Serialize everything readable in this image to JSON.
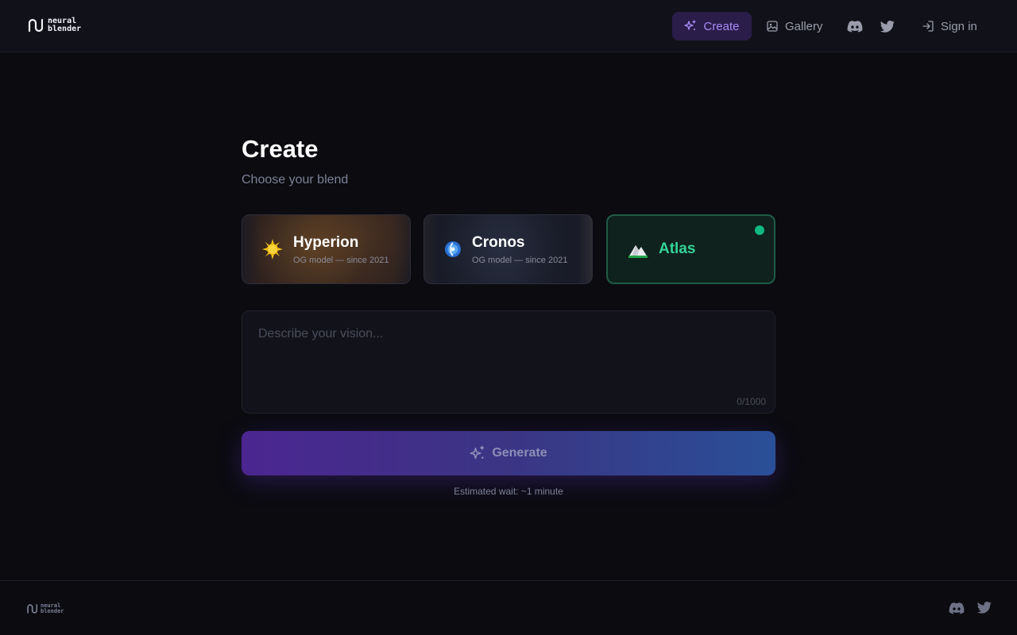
{
  "brand": {
    "name": "neural\nblender"
  },
  "nav": {
    "create_label": "Create",
    "gallery_label": "Gallery",
    "signin_label": "Sign in"
  },
  "page": {
    "title": "Create",
    "subtitle": "Choose your blend"
  },
  "models": [
    {
      "name": "Hyperion",
      "subtitle": "OG model — since 2021",
      "icon": "sun-icon"
    },
    {
      "name": "Cronos",
      "subtitle": "OG model — since 2021",
      "icon": "orb-icon"
    },
    {
      "name": "Atlas",
      "icon": "mountain-icon",
      "selected": true
    }
  ],
  "prompt": {
    "placeholder": "Describe your vision...",
    "char_count": "0/1000"
  },
  "generate": {
    "label": "Generate",
    "wait_text": "Estimated wait: ~1 minute"
  },
  "colors": {
    "accent": "#a88cf7",
    "selected": "#34d399"
  }
}
